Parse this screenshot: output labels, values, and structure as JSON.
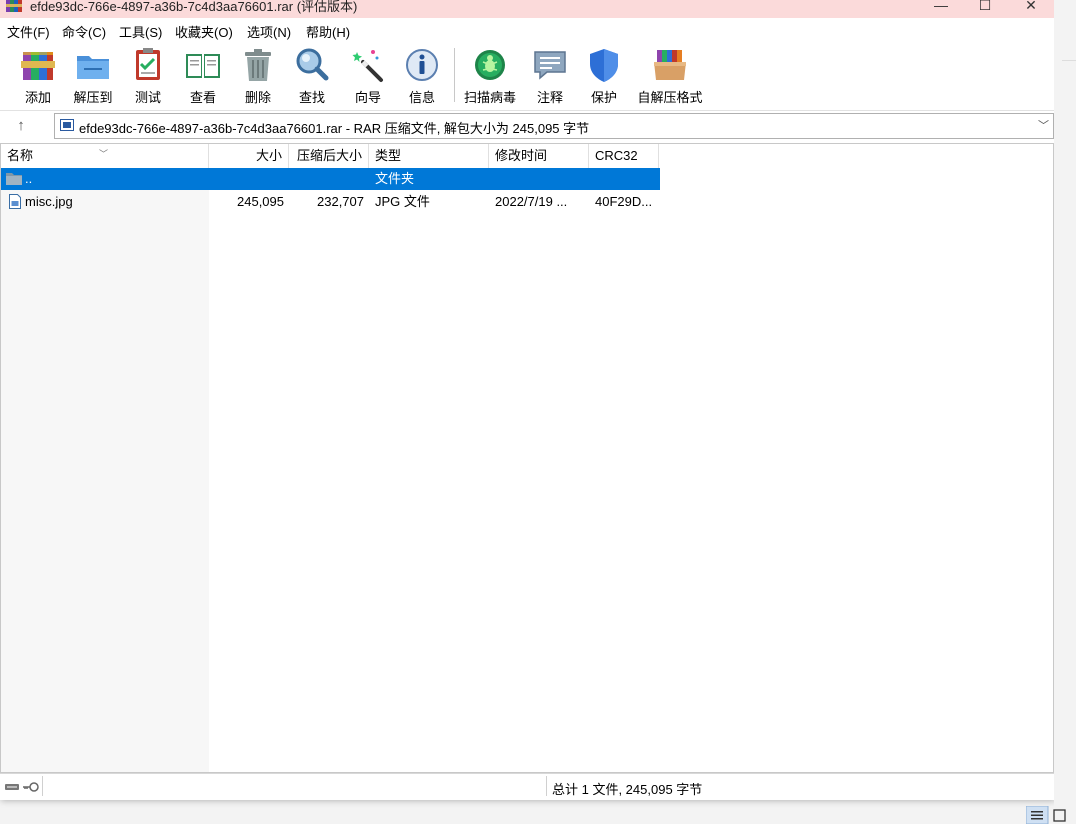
{
  "window": {
    "title": "efde93dc-766e-4897-a36b-7c4d3aa76601.rar (评估版本)",
    "controls": {
      "minimize": "—",
      "maximize": "☐",
      "close": "✕"
    }
  },
  "menu": [
    {
      "label": "文件(F)"
    },
    {
      "label": "命令(C)"
    },
    {
      "label": "工具(S)"
    },
    {
      "label": "收藏夹(O)"
    },
    {
      "label": "选项(N)"
    },
    {
      "label": "帮助(H)"
    }
  ],
  "toolbar": [
    {
      "label": "添加",
      "icon": "add-archive-icon"
    },
    {
      "label": "解压到",
      "icon": "extract-to-icon"
    },
    {
      "label": "测试",
      "icon": "test-icon"
    },
    {
      "label": "查看",
      "icon": "view-book-icon"
    },
    {
      "label": "删除",
      "icon": "trash-icon"
    },
    {
      "label": "查找",
      "icon": "find-magnifier-icon"
    },
    {
      "label": "向导",
      "icon": "wizard-wand-icon"
    },
    {
      "label": "信息",
      "icon": "info-icon"
    },
    {
      "label": "扫描病毒",
      "icon": "virus-scan-icon"
    },
    {
      "label": "注释",
      "icon": "comment-icon"
    },
    {
      "label": "保护",
      "icon": "shield-icon"
    },
    {
      "label": "自解压格式",
      "icon": "sfx-box-icon"
    }
  ],
  "address": {
    "text": "efde93dc-766e-4897-a36b-7c4d3aa76601.rar - RAR 压缩文件, 解包大小为 245,095 字节",
    "up": "↑",
    "dropdown": "﹀"
  },
  "columns": [
    {
      "label": "名称"
    },
    {
      "label": "大小"
    },
    {
      "label": "压缩后大小"
    },
    {
      "label": "类型"
    },
    {
      "label": "修改时间"
    },
    {
      "label": "CRC32"
    }
  ],
  "rows": [
    {
      "name": "..",
      "size": "",
      "packed": "",
      "type": "文件夹",
      "modified": "",
      "crc": "",
      "selected": true
    },
    {
      "name": "misc.jpg",
      "size": "245,095",
      "packed": "232,707",
      "type": "JPG 文件",
      "modified": "2022/7/19 ...",
      "crc": "40F29D...",
      "selected": false
    }
  ],
  "status": {
    "summary": "总计 1 文件, 245,095 字节"
  },
  "colors": {
    "title_bar": "#fbdada",
    "selection": "#0078d7"
  }
}
